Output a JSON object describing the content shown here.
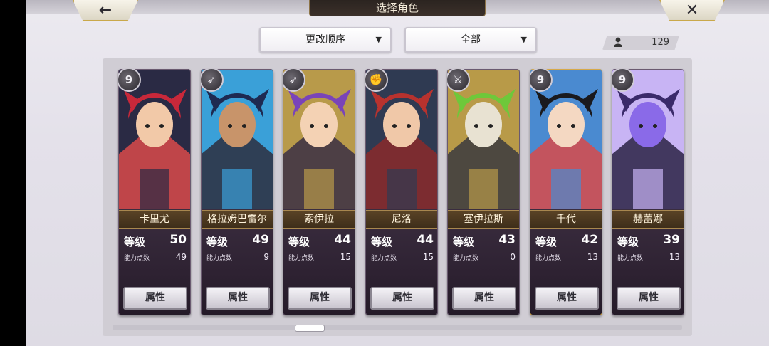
{
  "header": {
    "title": "选择角色",
    "back_icon": "←",
    "close_icon": "✕"
  },
  "filters": {
    "order_label": "更改顺序",
    "filter_label": "全部",
    "dropdown_arrow": "▼"
  },
  "character_count": "129",
  "labels": {
    "level": "等级",
    "ability_points": "能力点数",
    "attribute_button": "属性"
  },
  "characters": [
    {
      "name": "卡里尤",
      "level": "50",
      "ability_points": "49",
      "weapon_icon": "9",
      "frame": "purple",
      "colors": [
        "#c8283a",
        "#f2c9a8",
        "#2a2a44",
        "#d94a4a"
      ]
    },
    {
      "name": "格拉姆巴雷尔",
      "level": "49",
      "ability_points": "9",
      "weapon_icon": "➶",
      "frame": "purple",
      "colors": [
        "#1e2a52",
        "#c8946a",
        "#3aa0d8",
        "#2e2e3e"
      ]
    },
    {
      "name": "索伊拉",
      "level": "44",
      "ability_points": "15",
      "weapon_icon": "➶",
      "frame": "purple",
      "colors": [
        "#7a44b8",
        "#f4d2b4",
        "#b89a4a",
        "#3a2f44"
      ]
    },
    {
      "name": "尼洛",
      "level": "44",
      "ability_points": "15",
      "weapon_icon": "✊",
      "frame": "purple",
      "colors": [
        "#b8322e",
        "#f0c8a8",
        "#2f3a52",
        "#8a2a2a"
      ]
    },
    {
      "name": "塞伊拉斯",
      "level": "43",
      "ability_points": "0",
      "weapon_icon": "⚔",
      "frame": "purple",
      "colors": [
        "#6ec83a",
        "#e8e2d2",
        "#b89a48",
        "#3a3a40"
      ]
    },
    {
      "name": "千代",
      "level": "42",
      "ability_points": "13",
      "weapon_icon": "9",
      "frame": "gold",
      "colors": [
        "#1a1a1e",
        "#f4d8c2",
        "#4a8ad0",
        "#d84a4a"
      ]
    },
    {
      "name": "赫蕾娜",
      "level": "39",
      "ability_points": "13",
      "weapon_icon": "9",
      "frame": "purple",
      "colors": [
        "#3a2a6a",
        "#8a6ae8",
        "#c8b4f4",
        "#2a2244"
      ]
    }
  ]
}
